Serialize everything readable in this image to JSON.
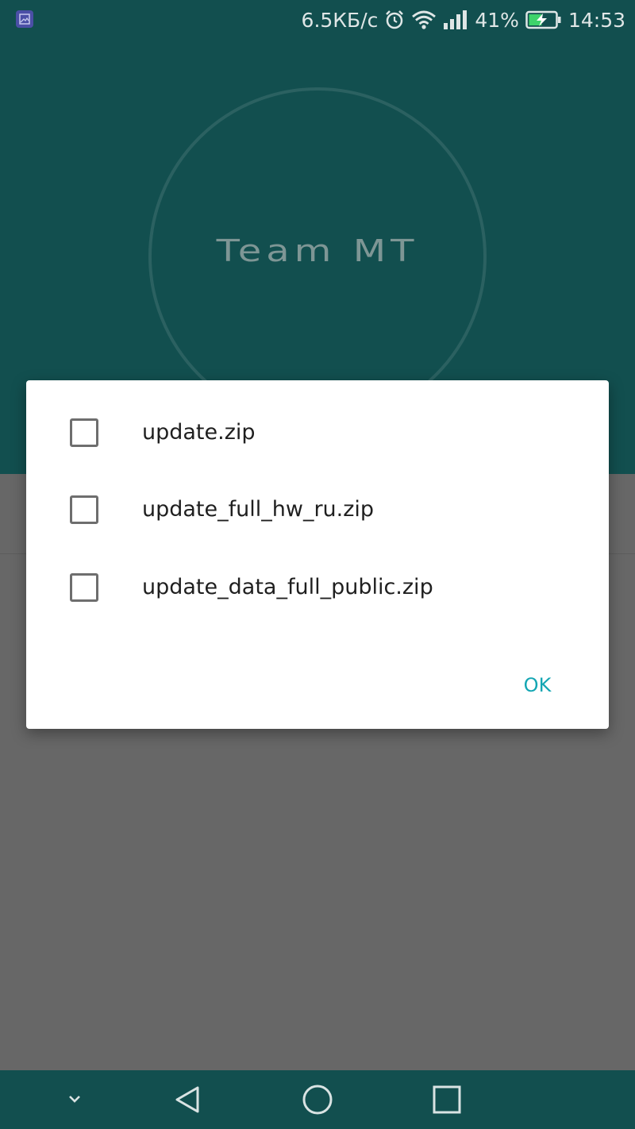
{
  "status_bar": {
    "net_speed": "6.5КБ/с",
    "battery": "41%",
    "time": "14:53",
    "icons": [
      "gallery-notification-icon",
      "alarm-icon",
      "wifi-icon",
      "signal-icon",
      "battery-charging-icon"
    ]
  },
  "app": {
    "logo_text": "Team MT",
    "header_color": "#124f4f"
  },
  "dialog": {
    "options": [
      {
        "label": "update.zip",
        "checked": false
      },
      {
        "label": "update_full_hw_ru.zip",
        "checked": false
      },
      {
        "label": "update_data_full_public.zip",
        "checked": false
      }
    ],
    "ok_label": "OK",
    "accent_color": "#14a6b3"
  },
  "nav_bar": {
    "icons": [
      "chevron-down-icon",
      "back-icon",
      "home-icon",
      "recents-icon"
    ]
  }
}
